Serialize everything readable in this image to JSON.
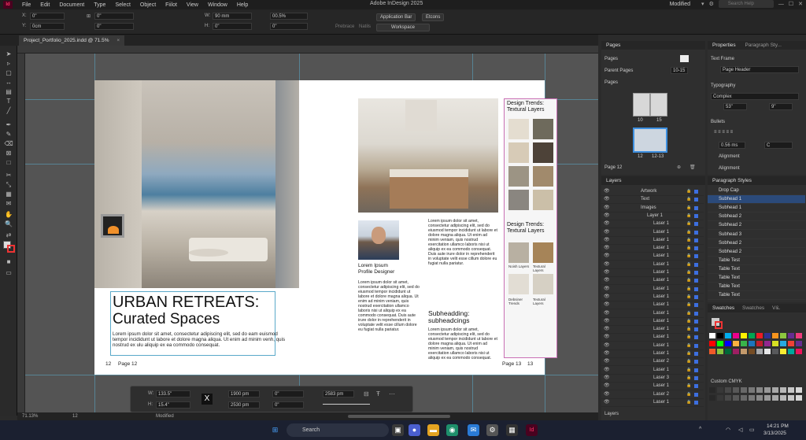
{
  "app": {
    "title": "Adobe InDesign 2025",
    "logo": "Id",
    "menu": [
      "File",
      "Edit",
      "Document",
      "Type",
      "Select",
      "Object",
      "Fiilot",
      "View",
      "Window",
      "Help"
    ],
    "modified": "Modified",
    "search_placeholder": "Search Help"
  },
  "control_bar": {
    "x_label": "X:",
    "x_value": "0\"",
    "y_label": "Y:",
    "y_value": "0cm",
    "w_label": "W:",
    "w_value": "90 mm",
    "h_label": "H:",
    "h_value": "0\"",
    "scale_x": "00.5%",
    "scale_y": "0\"",
    "angle": "0\"",
    "shear": "0\"",
    "presets": [
      "Prebrace",
      "Natils"
    ],
    "application_bar": "Application Bar",
    "options": "Etcons",
    "workspace": "Workspace"
  },
  "document_tab": {
    "name": "Project_Portfolio_2025.indd @ 71.5%",
    "close": "×"
  },
  "spread": {
    "left_page": {
      "headline_line1": "URBAN RETREATS:",
      "headline_line2": "Curated Spaces",
      "body": "Lorem ipsum dolor sit amet, consectetur adipiscing elit, sed do eam euismod tempor incididunt ut labore et dolore magna aliqua. Ut enim ad minim venh, quis nostrud ex ulu aliquip ex ea commodo consequat.",
      "folio_number": "12",
      "folio_label": "Page 12"
    },
    "right_page": {
      "profile_name": "Lorem Ipsum",
      "profile_title": "Profile Designer",
      "col1_text": "Lorem ipsum dolor sit amet, consectetur adipiscing elit, sed do eiusmod tempor incididunt ut labore et dolore magna aliqua. Ut enim ad minim veniam, quis nostrud exercitation ullamco laboris nisi ut aliquip ex ea commodo consequat. Duis aute irure dolor in reprehenderit in voluptate velit esse cillum dolore eu fugiat nulla pariatur.",
      "col2_text": "Lorem ipsum dolor sit amet, consectetur adipiscing elit, sed do eiusmod tempor incididunt ut labore et dolore magna aliqua. Ut enim ad minim veniam, quis nostrud exercitation ullamco laboris nisi ut aliquip ex ea commodo consequat. Duis aute irure dolor in reprehenderit in voluptate velit esse cillum dolore eu fugiat nulla pariatur.",
      "subheading": "Subheadding: subheadcings",
      "col2_text_b": "Lorem ipsum dolor sit amet, consectetur adipiscing elit, sed do eiusmod tempor incididunt ut labore et dolore magna aliqua. Ut enim ad minim veniam, quis nostrud exercitation ullamco laboris nisi ut aliquip ex ea commodo consequat.",
      "sidebar_title1": "Design Trends: Textural Layers",
      "sidebar_title2": "Design Trends: Textural Layers",
      "texture_labels": [
        "Noish Layers",
        "Textural Layers",
        "Debsiner Trends",
        "Textural Layers"
      ],
      "folio_label": "Page 13",
      "folio_number": "13"
    }
  },
  "bottom_control": {
    "w_label": "W:",
    "w_value": "133.5\"",
    "h_label": "H:",
    "h_value": "15.4\"",
    "w2_value": "1900 pm",
    "h2_value": "2530 pm",
    "y_value": "0\"",
    "a_value": "0\"",
    "extra_value": "2583 pm",
    "x_badge": "X"
  },
  "status_bar": {
    "zoom": "71.13%",
    "page": "12",
    "state": "Modified"
  },
  "pages_panel": {
    "tab": "Pages",
    "pages_label": "Pages",
    "parent_pages_label": "Parent Pages",
    "parent_value": "10-15",
    "pages_label2": "Pages",
    "thumb_labels": [
      "10",
      "15",
      "12",
      "12-13"
    ],
    "footer": "Page 12"
  },
  "properties_panel": {
    "tabs": [
      "Properties",
      "Paragraph Sty..."
    ],
    "text_frame": "Text Frame",
    "page_header": "Page Header",
    "typography": "Typography",
    "font_style": "Complex",
    "size": "53\"",
    "leading": "9\"",
    "bullets": "Bullets",
    "indent": "0.56 ms",
    "indent_unit": "C",
    "alignment": "Alignment",
    "alignment2": "Alignment"
  },
  "layers_panel": {
    "tab": "Layers",
    "rows": [
      "Artwork",
      "Text",
      "Images",
      "Layer 1",
      "Laser 1",
      "Laser 1",
      "Laser 1",
      "Laser 1",
      "Laser 1",
      "Laser 1",
      "Laser 1",
      "Laser 1",
      "Laser 1",
      "Laser 1",
      "Laser 1",
      "Laser 1",
      "Laser 1",
      "Laser 1",
      "Laser 1",
      "Laser 1",
      "Laser 1",
      "Laser 2",
      "Laser 1",
      "Laser 3",
      "Laser 1",
      "Laser 2",
      "Laser 1"
    ],
    "footer": "Layers"
  },
  "paragraph_styles_panel": {
    "tab": "Paragraph Styles",
    "rows": [
      "Drop Cap",
      "Subhead 1",
      "Subhead 1",
      "Sobhead 2",
      "Subhead 2",
      "Subhead 3",
      "Sobhead 2",
      "Sobhead 2",
      "Table Test",
      "Table Text",
      "Table Text",
      "Table Text",
      "Table Text"
    ]
  },
  "swatches_panel": {
    "tabs": [
      "Swatches",
      "Swatches",
      "V&."
    ],
    "custom": "Custom CMYK",
    "colors": [
      "#ffffff",
      "#000000",
      "#00aeef",
      "#ec008c",
      "#fff200",
      "#00a651",
      "#ed1c24",
      "#2e3192",
      "#f7941d",
      "#8dc63f",
      "#662d91",
      "#ee3b7c",
      "#ff0000",
      "#00ff00",
      "#0000ff",
      "#fbb040",
      "#39b54a",
      "#1c75bc",
      "#be1e2d",
      "#92278f",
      "#d7df23",
      "#27aae1",
      "#ef4136",
      "#662d91",
      "#f15a29",
      "#8cc63f",
      "#006838",
      "#9e1f63",
      "#c49a6c",
      "#754c24",
      "#a7a9ac",
      "#e6e7e8",
      "#58595b",
      "#f9ed32",
      "#00a99d",
      "#ed145b"
    ]
  },
  "taskbar": {
    "search": "Search",
    "time": "14:21 PM",
    "date": "3/13/2025"
  }
}
